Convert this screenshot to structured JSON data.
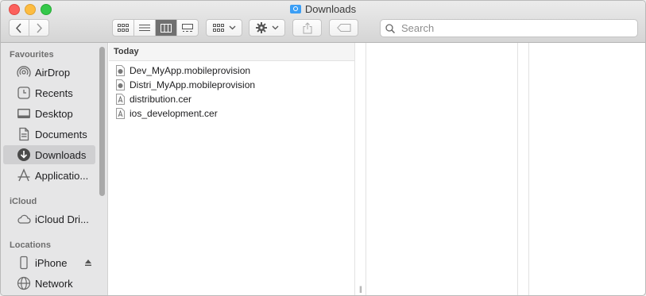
{
  "window": {
    "title": "Downloads"
  },
  "toolbar": {
    "back_icon": "chevron-left-icon",
    "forward_icon": "chevron-right-icon",
    "views": [
      "icon-view",
      "list-view",
      "column-view",
      "gallery-view"
    ],
    "active_view": "column-view",
    "group_icon": "group-by-icon",
    "action_icon": "gear-icon",
    "share_icon": "share-icon",
    "tag_icon": "tag-icon"
  },
  "search": {
    "placeholder": "Search",
    "value": ""
  },
  "sidebar": {
    "favourites_heading": "Favourites",
    "favourites": [
      {
        "label": "AirDrop",
        "icon": "airdrop-icon"
      },
      {
        "label": "Recents",
        "icon": "clock-icon"
      },
      {
        "label": "Desktop",
        "icon": "desktop-icon"
      },
      {
        "label": "Documents",
        "icon": "document-icon"
      },
      {
        "label": "Downloads",
        "icon": "download-icon",
        "selected": true
      },
      {
        "label": "Applicatio...",
        "icon": "applications-icon"
      }
    ],
    "icloud_heading": "iCloud",
    "icloud": [
      {
        "label": "iCloud Dri...",
        "icon": "cloud-icon"
      }
    ],
    "locations_heading": "Locations",
    "locations": [
      {
        "label": "iPhone",
        "icon": "iphone-icon",
        "eject": "eject-icon"
      },
      {
        "label": "Network",
        "icon": "network-icon"
      }
    ]
  },
  "column1": {
    "header": "Today",
    "files": [
      {
        "name": "Dev_MyApp.mobileprovision",
        "icon": "mobileprovision-file-icon"
      },
      {
        "name": "Distri_MyApp.mobileprovision",
        "icon": "mobileprovision-file-icon"
      },
      {
        "name": "distribution.cer",
        "icon": "certificate-file-icon"
      },
      {
        "name": "ios_development.cer",
        "icon": "certificate-file-icon"
      }
    ]
  },
  "colors": {
    "selected_bg": "#cfcfd1",
    "sidebar_bg": "#e6e6e7",
    "folder_blue": "#3b9ef5"
  }
}
